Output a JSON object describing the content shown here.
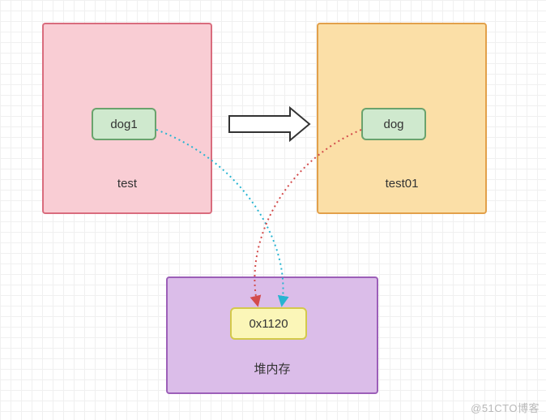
{
  "boxes": {
    "left": {
      "title": "test",
      "node": "dog1"
    },
    "right": {
      "title": "test01",
      "node": "dog"
    },
    "bottom": {
      "title": "堆内存",
      "node": "0x1120"
    }
  },
  "watermark": "@51CTO博客"
}
